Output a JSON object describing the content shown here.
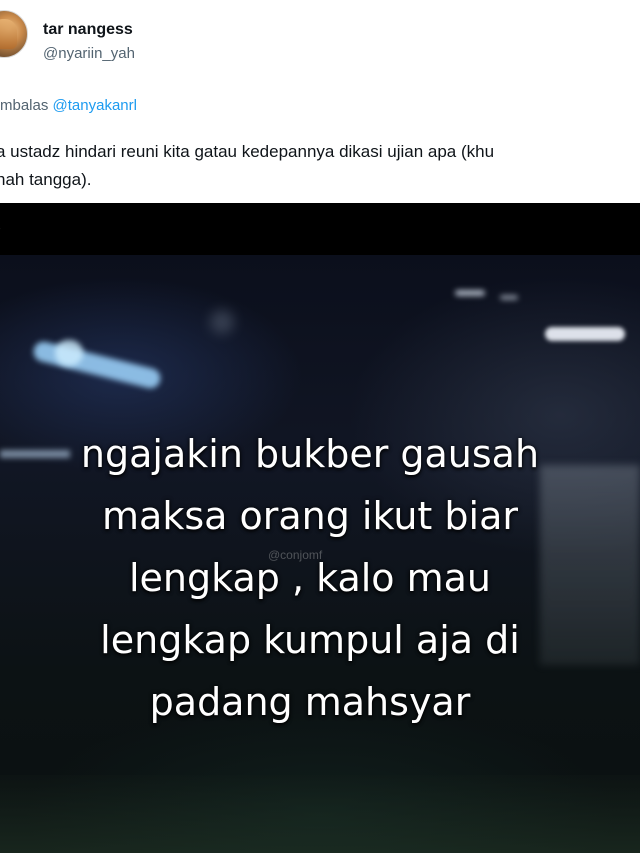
{
  "tweet": {
    "display_name": "tar nangess",
    "handle": "@nyariin_yah",
    "reply_prefix": "mbalas ",
    "reply_mention": "@tanyakanrl",
    "text_lines": [
      "a ustadz hindari reuni kita gatau kedepannya dikasi ujian apa (khu",
      "nah tangga)."
    ]
  },
  "media": {
    "platform_icon": "tiktok-icon",
    "watermark": "@conjomf",
    "overlay_lines": [
      "ngajakin bukber gausah",
      "maksa orang ikut biar",
      "lengkap , kalo mau",
      "lengkap kumpul aja di",
      "padang mahsyar"
    ]
  },
  "colors": {
    "link": "#1d9bf0",
    "secondary_text": "#536471",
    "primary_text": "#0f1419"
  }
}
